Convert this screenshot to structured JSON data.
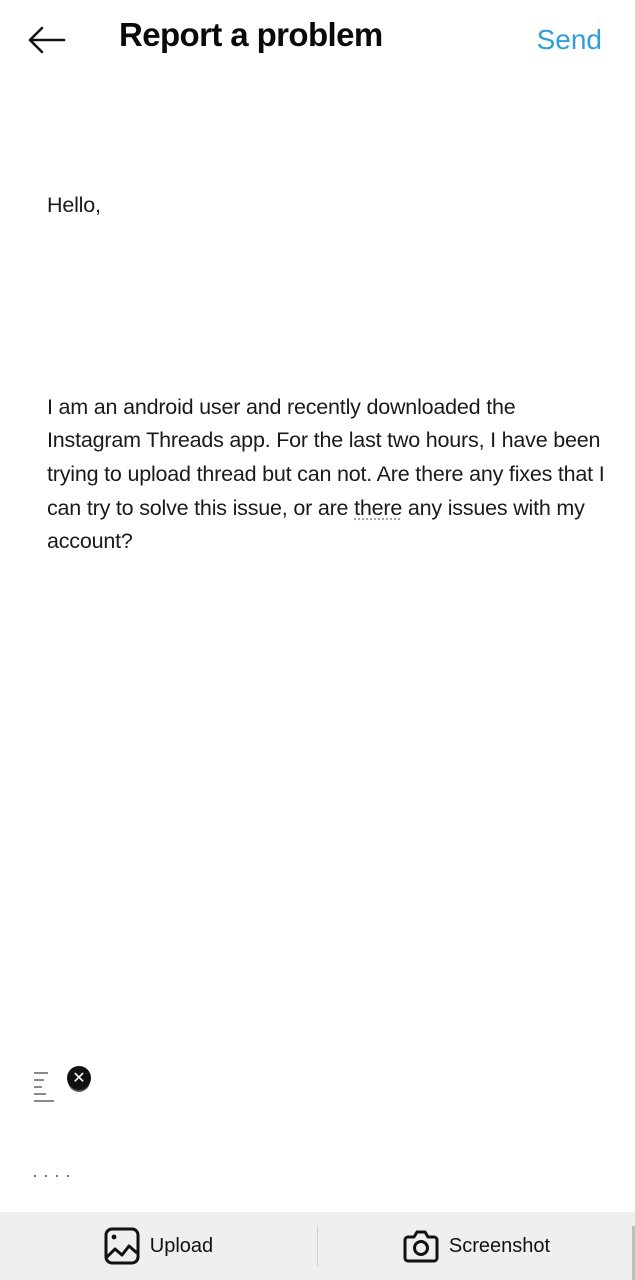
{
  "header": {
    "back_icon": "arrow-left-icon",
    "title": "Report a problem",
    "send_label": "Send",
    "send_color": "#2f9fd8"
  },
  "message": {
    "greeting": "Hello,",
    "body_before_flag": "I am an android user and recently downloaded the Instagram Threads app. For the last two hours, I have been trying to upload thread but can not. Are there any fixes that I can try to solve this issue, or are ",
    "flagged_word": "there",
    "body_after_flag": " any issues with my account?"
  },
  "attachment": {
    "remove_icon": "close-circle-icon",
    "remove_glyph": "✕"
  },
  "bottom_bar": {
    "upload_icon": "image-icon",
    "upload_label": "Upload",
    "screenshot_icon": "camera-icon",
    "screenshot_label": "Screenshot",
    "background": "#efefef"
  }
}
